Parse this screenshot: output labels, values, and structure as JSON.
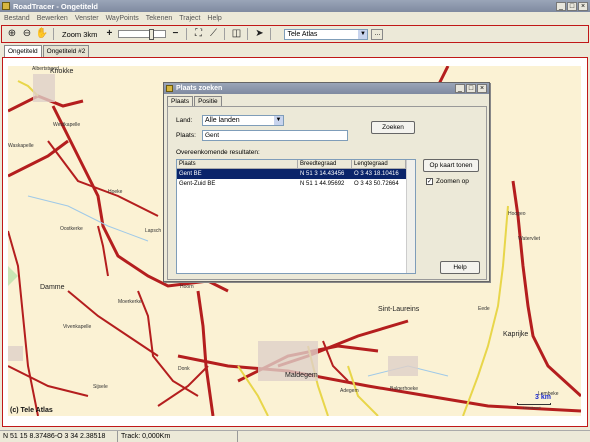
{
  "window": {
    "title": "RoadTracer - Ongetiteld",
    "controls": [
      "_",
      "□",
      "×"
    ]
  },
  "menu": [
    "Bestand",
    "Bewerken",
    "Venster",
    "WayPoints",
    "Tekenen",
    "Traject",
    "Help"
  ],
  "toolbar": {
    "zoom_label": "Zoom 3km",
    "map_source": "Tele Atlas",
    "more_label": "..."
  },
  "doc_tabs": [
    "Ongetiteld",
    "Ongetiteld #2"
  ],
  "map": {
    "copyright": "(c) Tele Atlas",
    "scale_label": "3 km",
    "scale_sub": "Leeskaart",
    "towns": [
      "Knokke",
      "Damme",
      "Maldegem",
      "Sint-Laureins",
      "Kaprijke"
    ],
    "places": [
      "Albertstrand",
      "Westkapelle",
      "Waskapelle",
      "Hoeke",
      "Oostkerke",
      "Lapsch",
      "Moerkerke",
      "Vivenkapelle",
      "Sijsele",
      "Donk",
      "Hoorn",
      "Balgerhoeke",
      "Adegem",
      "Watervliet",
      "Lembeke",
      "Eede",
      "Hoogeo"
    ]
  },
  "dialog": {
    "title": "Plaats zoeken",
    "tabs": [
      "Plaats",
      "Positie"
    ],
    "land_label": "Land:",
    "land_value": "Alle landen",
    "plaats_label": "Plaats:",
    "plaats_value": "Gent",
    "zoeken_button": "Zoeken",
    "results_label": "Overeenkomende resultaten:",
    "columns": [
      "Plaats",
      "Breedtegraad",
      "Lengtegraad"
    ],
    "rows": [
      [
        "Gent BE",
        "N 51 3 14.43456",
        "O 3 43 18.10416"
      ],
      [
        "Gent-Zuid BE",
        "N 51 1 44.95692",
        "O 3 43 50.72664"
      ]
    ],
    "op_kaart_button": "Op kaart tonen",
    "zoomen_label": "Zoomen op",
    "help_button": "Help"
  },
  "status": {
    "coords": "N 51 15 8.37486-O 3 34 2.38518",
    "track": "Track: 0,000Km"
  }
}
